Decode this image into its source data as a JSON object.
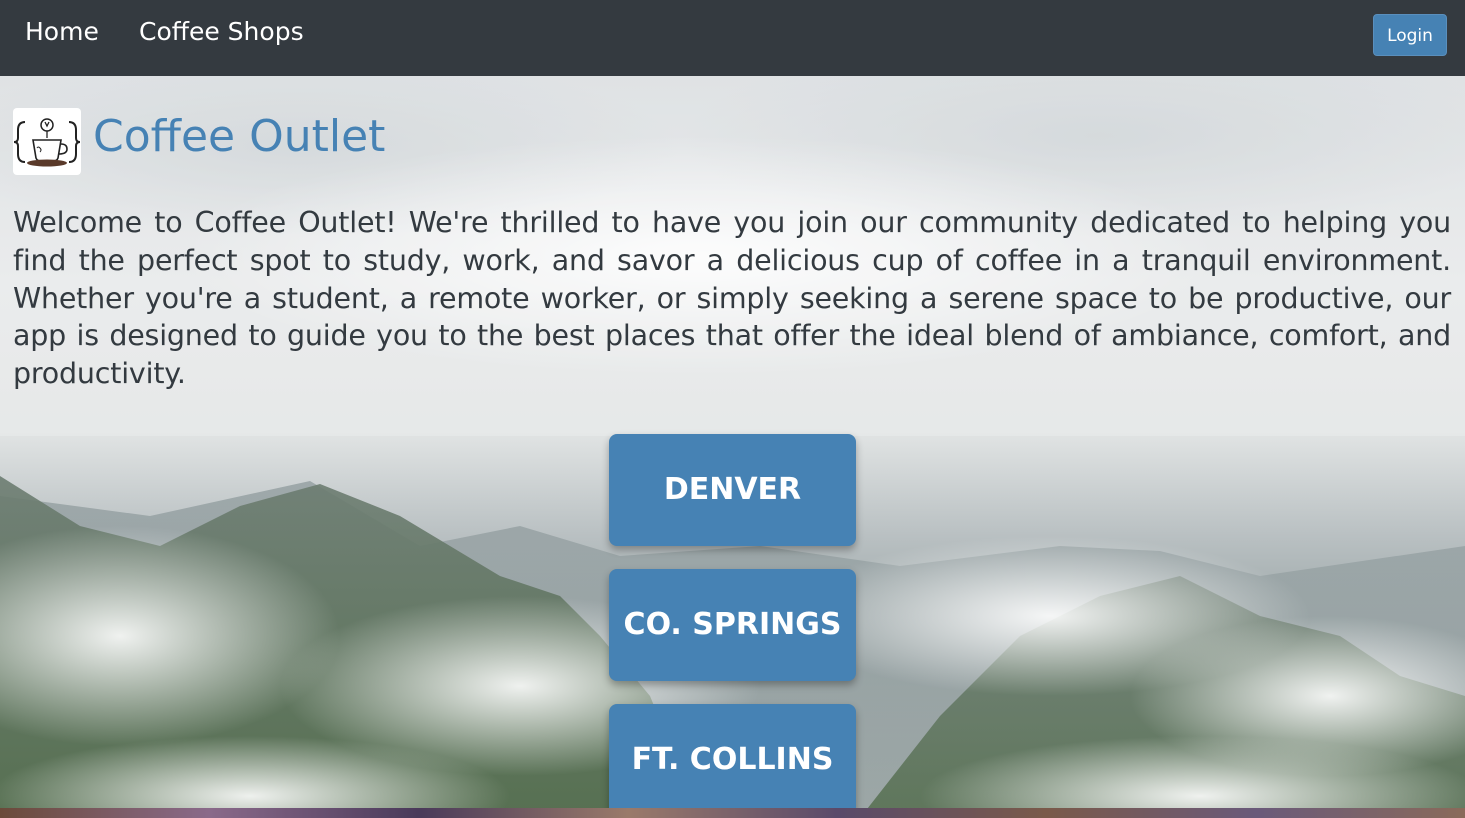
{
  "nav": {
    "home_label": "Home",
    "shops_label": "Coffee Shops",
    "login_label": "Login"
  },
  "header": {
    "logo_icon": "coffee-cup-icon",
    "title": "Coffee Outlet"
  },
  "intro": {
    "text": "Welcome to Coffee Outlet! We're thrilled to have you join our community dedicated to helping you find the perfect spot to study, work, and savor a delicious cup of coffee in a tranquil environment. Whether you're a student, a remote worker, or simply seeking a serene space to be productive, our app is designed to guide you to the best places that offer the ideal blend of ambiance, comfort, and productivity."
  },
  "cities": [
    {
      "label": "DENVER"
    },
    {
      "label": "CO. SPRINGS"
    },
    {
      "label": "FT. COLLINS"
    }
  ],
  "colors": {
    "navbar": "#343a40",
    "accent": "#4682b4",
    "text": "#333a40"
  }
}
